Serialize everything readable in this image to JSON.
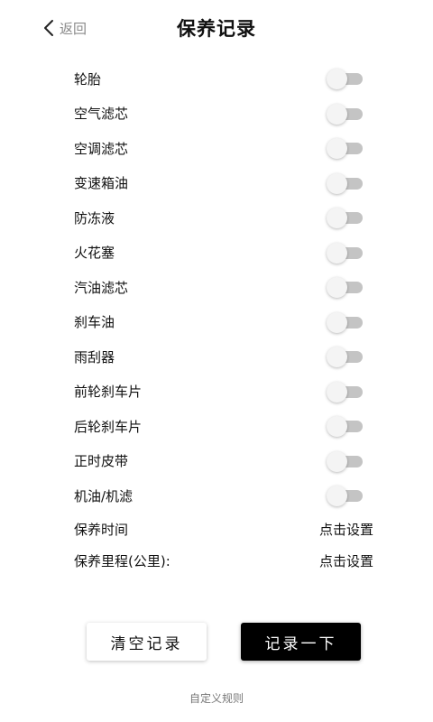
{
  "header": {
    "back_label": "返回",
    "title": "保养记录"
  },
  "items": [
    {
      "label": "轮胎",
      "enabled": false
    },
    {
      "label": "空气滤芯",
      "enabled": false
    },
    {
      "label": "空调滤芯",
      "enabled": false
    },
    {
      "label": "变速箱油",
      "enabled": false
    },
    {
      "label": "防冻液",
      "enabled": false
    },
    {
      "label": "火花塞",
      "enabled": false
    },
    {
      "label": "汽油滤芯",
      "enabled": false
    },
    {
      "label": "刹车油",
      "enabled": false
    },
    {
      "label": "雨刮器",
      "enabled": false
    },
    {
      "label": "前轮刹车片",
      "enabled": false
    },
    {
      "label": "后轮刹车片",
      "enabled": false
    },
    {
      "label": "正时皮带",
      "enabled": false
    },
    {
      "label": "机油/机滤",
      "enabled": false
    }
  ],
  "settings": {
    "time": {
      "label": "保养时间",
      "value": "点击设置"
    },
    "mileage": {
      "label": "保养里程(公里):",
      "value": "点击设置"
    }
  },
  "buttons": {
    "clear_label": "清空记录",
    "record_label": "记录一下"
  },
  "footer": {
    "link_label": "自定义规则"
  },
  "colors": {
    "primary_button": "#000000",
    "toggle_off_track": "#c4c4c4",
    "toggle_off_knob": "#f4f4f4"
  }
}
